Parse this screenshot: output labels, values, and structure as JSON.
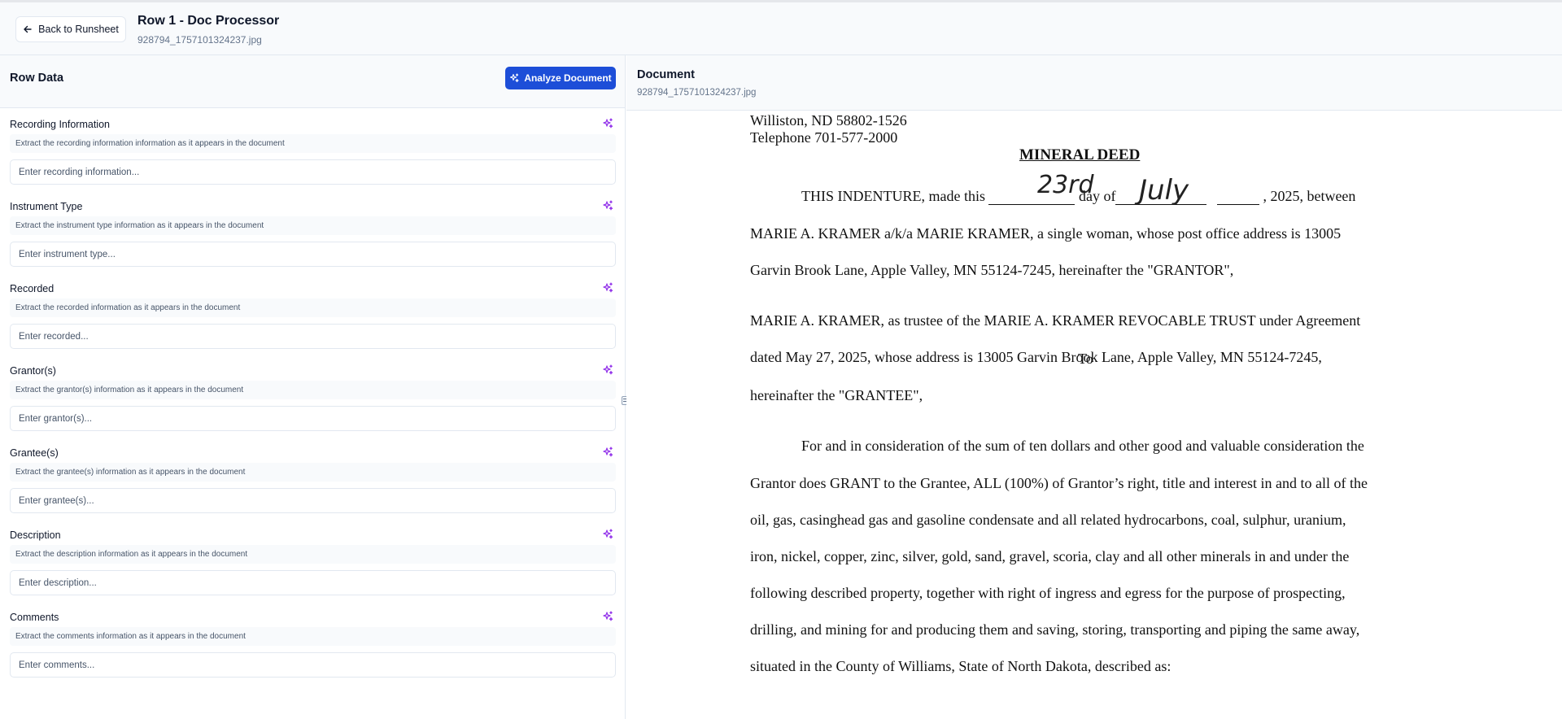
{
  "header": {
    "back_label": "Back to Runsheet",
    "title": "Row 1 - Doc Processor",
    "filename": "928794_1757101324237.jpg"
  },
  "left_panel": {
    "title": "Row Data",
    "analyze_label": "Analyze Document",
    "fields": [
      {
        "label": "Recording Information",
        "hint": "Extract the recording information information as it appears in the document",
        "placeholder": "Enter recording information...",
        "value": ""
      },
      {
        "label": "Instrument Type",
        "hint": "Extract the instrument type information as it appears in the document",
        "placeholder": "Enter instrument type...",
        "value": ""
      },
      {
        "label": "Recorded",
        "hint": "Extract the recorded information as it appears in the document",
        "placeholder": "Enter recorded...",
        "value": ""
      },
      {
        "label": "Grantor(s)",
        "hint": "Extract the grantor(s) information as it appears in the document",
        "placeholder": "Enter grantor(s)...",
        "value": ""
      },
      {
        "label": "Grantee(s)",
        "hint": "Extract the grantee(s) information as it appears in the document",
        "placeholder": "Enter grantee(s)...",
        "value": ""
      },
      {
        "label": "Description",
        "hint": "Extract the description information as it appears in the document",
        "placeholder": "Enter description...",
        "value": ""
      },
      {
        "label": "Comments",
        "hint": "Extract the comments information as it appears in the document",
        "placeholder": "Enter comments...",
        "value": ""
      }
    ]
  },
  "right_panel": {
    "title": "Document",
    "filename": "928794_1757101324237.jpg"
  },
  "document": {
    "address_line": "Williston, ND 58802-1526",
    "phone_line": "Telephone 701-577-2000",
    "deed_title": "MINERAL DEED",
    "indenture_start": "THIS INDENTURE, made this",
    "handwritten_day": "23rd",
    "day_of": "day of",
    "handwritten_month": "July",
    "year_between": ", 2025, between",
    "p1_line2": "MARIE A. KRAMER a/k/a MARIE KRAMER, a single woman, whose post office address is 13005",
    "p1_line3": "Garvin Brook Lane, Apple Valley, MN 55124-7245, hereinafter the \"GRANTOR\",",
    "to_word": "To",
    "p2_line1": "MARIE A. KRAMER, as trustee of the MARIE A. KRAMER REVOCABLE TRUST under Agreement",
    "p2_line2": "dated May 27, 2025, whose address is 13005 Garvin Brook Lane, Apple Valley, MN 55124-7245,",
    "p2_line3": "hereinafter the \"GRANTEE\",",
    "p3_line1": "For and in consideration of the sum of ten dollars and other good and valuable consideration the",
    "p3_line2": "Grantor does GRANT to the Grantee, ALL (100%) of Grantor’s right, title and interest in and to all of the",
    "p3_line3": "oil, gas, casinghead gas and gasoline condensate and all related hydrocarbons, coal, sulphur, uranium,",
    "p3_line4": "iron, nickel, copper, zinc, silver, gold, sand, gravel, scoria, clay and all other minerals in and under the",
    "p3_line5": "following described property, together with right of ingress and egress for the purpose of prospecting,",
    "p3_line6": "drilling, and mining for and producing them and saving, storing, transporting and piping the same away,",
    "p3_line7": "situated in the County of Williams, State of North Dakota, described as:"
  },
  "colors": {
    "primary_button": "#1d4ed8",
    "sparkle_icon": "#9333ea",
    "panel_header_bg": "#f8fafc",
    "border": "#e2e8f0"
  },
  "icons": {
    "back": "arrow-left-icon",
    "analyze": "sparkles-icon",
    "field_ai": "sparkles-icon",
    "splitter": "grip-icon"
  }
}
